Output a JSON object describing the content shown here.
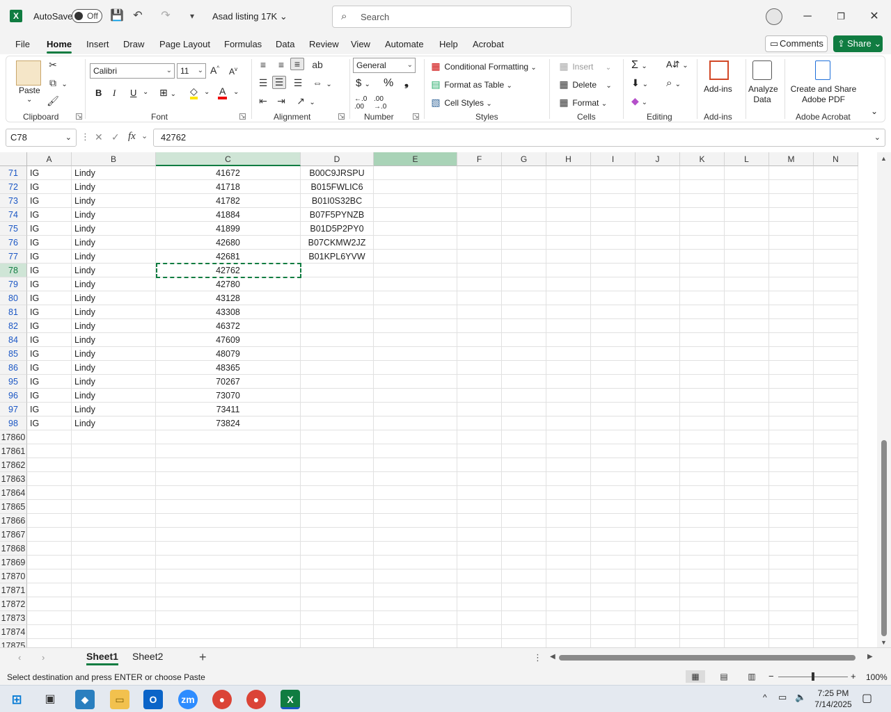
{
  "title_bar": {
    "autosave_label": "AutoSave",
    "autosave_state": "Off",
    "document_title": "Asad listing 17K",
    "search_placeholder": "Search"
  },
  "menu": {
    "tabs": [
      "File",
      "Home",
      "Insert",
      "Draw",
      "Page Layout",
      "Formulas",
      "Data",
      "Review",
      "View",
      "Automate",
      "Help",
      "Acrobat"
    ],
    "active_tab": "Home",
    "comments_label": "Comments",
    "share_label": "Share"
  },
  "ribbon": {
    "clipboard": {
      "paste": "Paste",
      "label": "Clipboard"
    },
    "font": {
      "name": "Calibri",
      "size": "11",
      "bold": "B",
      "italic": "I",
      "underline": "U",
      "label": "Font"
    },
    "alignment": {
      "label": "Alignment"
    },
    "number": {
      "format": "General",
      "label": "Number"
    },
    "styles": {
      "conditional": "Conditional Formatting",
      "table": "Format as Table",
      "cell_styles": "Cell Styles",
      "label": "Styles"
    },
    "cells": {
      "insert": "Insert",
      "delete": "Delete",
      "format": "Format",
      "label": "Cells"
    },
    "editing": {
      "label": "Editing"
    },
    "addins": {
      "addins": "Add-ins",
      "label": "Add-ins"
    },
    "analyze": {
      "line1": "Analyze",
      "line2": "Data"
    },
    "acrobat": {
      "line1": "Create and Share",
      "line2": "Adobe PDF",
      "label": "Adobe Acrobat"
    }
  },
  "formula_bar": {
    "name_box": "C78",
    "fx": "fx",
    "value": "42762"
  },
  "columns": [
    "A",
    "B",
    "C",
    "D",
    "E",
    "F",
    "G",
    "H",
    "I",
    "J",
    "K",
    "L",
    "M",
    "N"
  ],
  "rows": [
    {
      "n": "71",
      "a": "IG",
      "b": "Lindy",
      "c": "41672",
      "d": "B00C9JRSPU"
    },
    {
      "n": "72",
      "a": "IG",
      "b": "Lindy",
      "c": "41718",
      "d": "B015FWLIC6"
    },
    {
      "n": "73",
      "a": "IG",
      "b": "Lindy",
      "c": "41782",
      "d": "B01I0S32BC"
    },
    {
      "n": "74",
      "a": "IG",
      "b": "Lindy",
      "c": "41884",
      "d": "B07F5PYNZB"
    },
    {
      "n": "75",
      "a": "IG",
      "b": "Lindy",
      "c": "41899",
      "d": "B01D5P2PY0"
    },
    {
      "n": "76",
      "a": "IG",
      "b": "Lindy",
      "c": "42680",
      "d": "B07CKMW2JZ"
    },
    {
      "n": "77",
      "a": "IG",
      "b": "Lindy",
      "c": "42681",
      "d": "B01KPL6YVW"
    },
    {
      "n": "78",
      "a": "IG",
      "b": "Lindy",
      "c": "42762",
      "d": ""
    },
    {
      "n": "79",
      "a": "IG",
      "b": "Lindy",
      "c": "42780",
      "d": ""
    },
    {
      "n": "80",
      "a": "IG",
      "b": "Lindy",
      "c": "43128",
      "d": ""
    },
    {
      "n": "81",
      "a": "IG",
      "b": "Lindy",
      "c": "43308",
      "d": ""
    },
    {
      "n": "82",
      "a": "IG",
      "b": "Lindy",
      "c": "46372",
      "d": ""
    },
    {
      "n": "84",
      "a": "IG",
      "b": "Lindy",
      "c": "47609",
      "d": ""
    },
    {
      "n": "85",
      "a": "IG",
      "b": "Lindy",
      "c": "48079",
      "d": ""
    },
    {
      "n": "86",
      "a": "IG",
      "b": "Lindy",
      "c": "48365",
      "d": ""
    },
    {
      "n": "95",
      "a": "IG",
      "b": "Lindy",
      "c": "70267",
      "d": ""
    },
    {
      "n": "96",
      "a": "IG",
      "b": "Lindy",
      "c": "73070",
      "d": ""
    },
    {
      "n": "97",
      "a": "IG",
      "b": "Lindy",
      "c": "73411",
      "d": ""
    },
    {
      "n": "98",
      "a": "IG",
      "b": "Lindy",
      "c": "73824",
      "d": ""
    },
    {
      "n": "17860",
      "a": "",
      "b": "",
      "c": "",
      "d": ""
    },
    {
      "n": "17861",
      "a": "",
      "b": "",
      "c": "",
      "d": ""
    },
    {
      "n": "17862",
      "a": "",
      "b": "",
      "c": "",
      "d": ""
    },
    {
      "n": "17863",
      "a": "",
      "b": "",
      "c": "",
      "d": ""
    },
    {
      "n": "17864",
      "a": "",
      "b": "",
      "c": "",
      "d": ""
    },
    {
      "n": "17865",
      "a": "",
      "b": "",
      "c": "",
      "d": ""
    },
    {
      "n": "17866",
      "a": "",
      "b": "",
      "c": "",
      "d": ""
    },
    {
      "n": "17867",
      "a": "",
      "b": "",
      "c": "",
      "d": ""
    },
    {
      "n": "17868",
      "a": "",
      "b": "",
      "c": "",
      "d": ""
    },
    {
      "n": "17869",
      "a": "",
      "b": "",
      "c": "",
      "d": ""
    },
    {
      "n": "17870",
      "a": "",
      "b": "",
      "c": "",
      "d": ""
    },
    {
      "n": "17871",
      "a": "",
      "b": "",
      "c": "",
      "d": ""
    },
    {
      "n": "17872",
      "a": "",
      "b": "",
      "c": "",
      "d": ""
    },
    {
      "n": "17873",
      "a": "",
      "b": "",
      "c": "",
      "d": ""
    },
    {
      "n": "17874",
      "a": "",
      "b": "",
      "c": "",
      "d": ""
    },
    {
      "n": "17875",
      "a": "",
      "b": "",
      "c": "",
      "d": ""
    }
  ],
  "sheets": [
    "Sheet1",
    "Sheet2"
  ],
  "active_sheet": "Sheet1",
  "status": {
    "message": "Select destination and press ENTER or choose Paste",
    "zoom": "100%"
  },
  "taskbar": {
    "time": "7:25 PM",
    "date": "7/14/2025"
  },
  "colors": {
    "accent": "#107c41",
    "filtered_row": "#1a56c4"
  }
}
